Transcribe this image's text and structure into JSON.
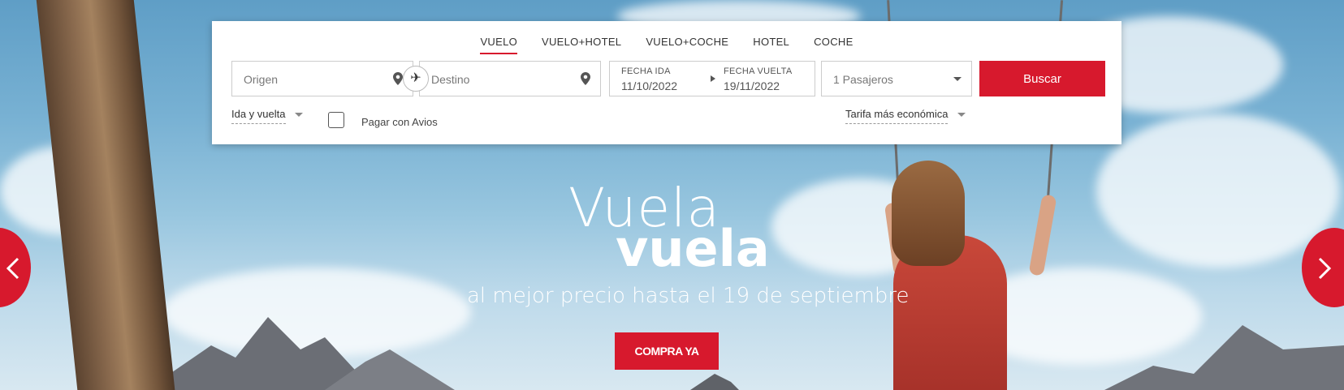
{
  "tabs": [
    {
      "label": "VUELO",
      "active": true
    },
    {
      "label": "VUELO+HOTEL",
      "active": false
    },
    {
      "label": "VUELO+COCHE",
      "active": false
    },
    {
      "label": "HOTEL",
      "active": false
    },
    {
      "label": "COCHE",
      "active": false
    }
  ],
  "search": {
    "origin_placeholder": "Origen",
    "destination_placeholder": "Destino",
    "swap_icon": "plane-swap-icon",
    "date_out_label": "FECHA IDA",
    "date_out_value": "11/10/2022",
    "date_return_label": "FECHA VUELTA",
    "date_return_value": "19/11/2022",
    "passengers": "1 Pasajeros",
    "search_button": "Buscar",
    "trip_type": "Ida y vuelta",
    "avios_label": "Pagar con Avios",
    "avios_checked": false,
    "fare": "Tarifa más económica"
  },
  "hero": {
    "line1": "Vuela",
    "line2": "vuela",
    "subtitle": "al mejor precio hasta el 19 de septiembre",
    "cta": "COMPRA YA"
  },
  "colors": {
    "accent": "#d7192d"
  }
}
